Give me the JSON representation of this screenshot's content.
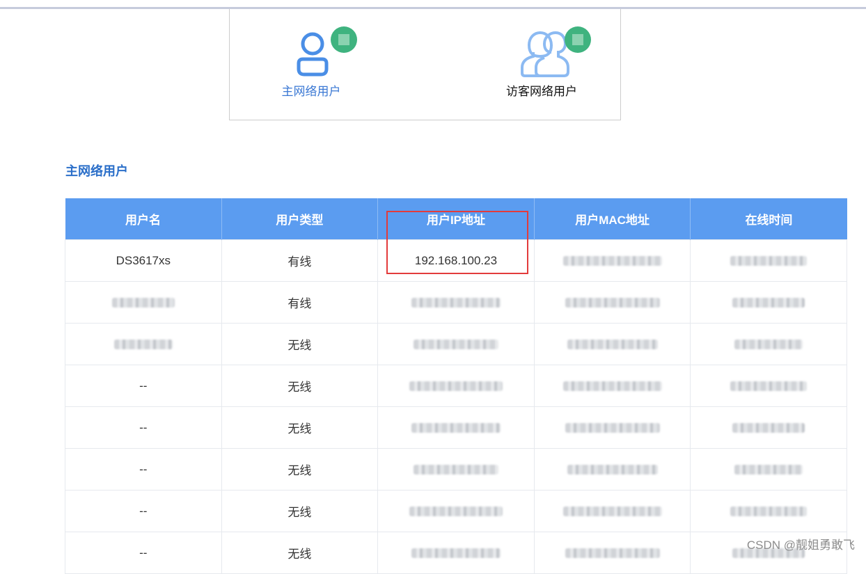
{
  "tabs": [
    {
      "label": "主网络用户",
      "active": true,
      "icon": "user-icon"
    },
    {
      "label": "访客网络用户",
      "active": false,
      "icon": "users-group-icon"
    }
  ],
  "section_title": "主网络用户",
  "table": {
    "headers": [
      "用户名",
      "用户类型",
      "用户IP地址",
      "用户MAC地址",
      "在线时间"
    ],
    "rows": [
      {
        "name": "DS3617xs",
        "type": "有线",
        "ip": "192.168.100.23",
        "mac": null,
        "online": null
      },
      {
        "name": null,
        "type": "有线",
        "ip": null,
        "mac": null,
        "online": null
      },
      {
        "name": null,
        "type": "无线",
        "ip": null,
        "mac": null,
        "online": null
      },
      {
        "name": "--",
        "type": "无线",
        "ip": null,
        "mac": null,
        "online": null
      },
      {
        "name": "--",
        "type": "无线",
        "ip": null,
        "mac": null,
        "online": null
      },
      {
        "name": "--",
        "type": "无线",
        "ip": null,
        "mac": null,
        "online": null
      },
      {
        "name": "--",
        "type": "无线",
        "ip": null,
        "mac": null,
        "online": null
      },
      {
        "name": "--",
        "type": "无线",
        "ip": null,
        "mac": null,
        "online": null
      }
    ]
  },
  "colors": {
    "accent": "#3a78d4",
    "header_bg": "#5b9cf0",
    "badge": "#3fb37f",
    "highlight": "#e33b3b"
  },
  "watermark": "CSDN @靓姐勇敢飞"
}
